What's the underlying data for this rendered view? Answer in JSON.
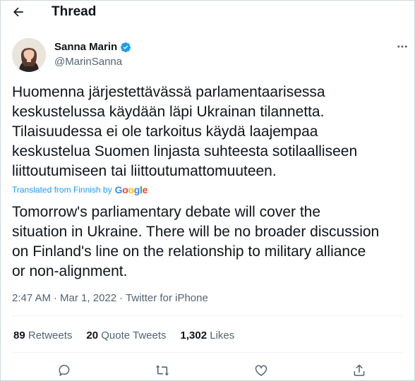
{
  "header": {
    "title": "Thread",
    "back_icon": "back-arrow-icon"
  },
  "author": {
    "name": "Sanna Marin",
    "handle": "@MarinSanna",
    "verified_color": "#1d9bf0"
  },
  "tweet": {
    "original_text": "Huomenna järjestettävässä parlamentaarisessa\nkeskustelussa käydään läpi Ukrainan tilannetta.\nTilaisuudessa ei ole tarkoitus käydä laajempaa\nkeskustelua Suomen linjasta suhteesta sotilaalliseen\nliittoutumiseen tai liittoutumattomuuteen.",
    "translated_label": "Translated from Finnish by",
    "translator": "Google",
    "translation_text": "Tomorrow's parliamentary debate will cover the\nsituation in Ukraine. There will be no broader discussion\non Finland's line on the relationship to military alliance\nor non-alignment.",
    "time": "2:47 AM",
    "date": "Mar 1, 2022",
    "source": "Twitter for iPhone",
    "separator": "·"
  },
  "stats": {
    "retweets_count": "89",
    "retweets_label": "Retweets",
    "quotes_count": "20",
    "quotes_label": "Quote Tweets",
    "likes_count": "1,302",
    "likes_label": "Likes"
  },
  "colors": {
    "text": "#0f1419",
    "secondary": "#536471",
    "accent": "#1d9bf0",
    "border": "#cfd9de"
  }
}
